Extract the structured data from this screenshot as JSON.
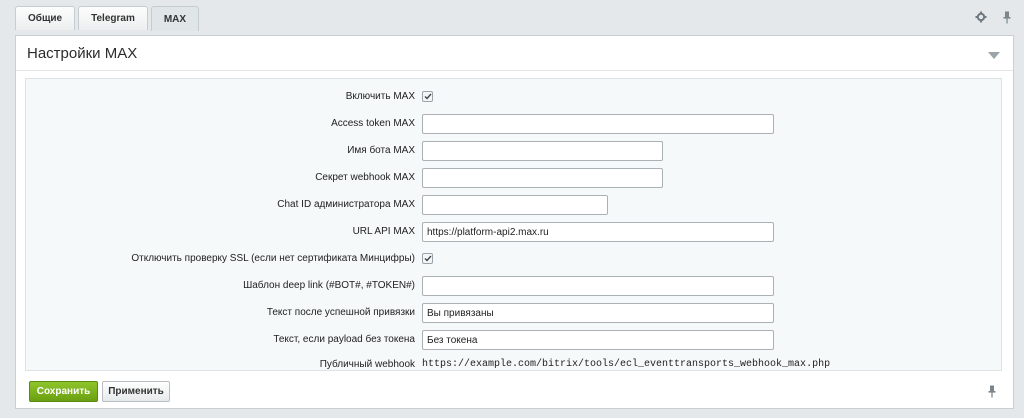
{
  "tabs": [
    {
      "label": "Общие"
    },
    {
      "label": "Telegram"
    },
    {
      "label": "MAX"
    }
  ],
  "active_tab": "MAX",
  "tab_tools": {
    "settings_icon": "gear-icon",
    "pin_icon": "pin-icon"
  },
  "panel": {
    "title": "Настройки MAX",
    "collapse_icon": "triangle-down-icon"
  },
  "form": {
    "enable_max": {
      "label": "Включить MAX",
      "checked": true
    },
    "access_token": {
      "label": "Access token MAX",
      "value": ""
    },
    "bot_name": {
      "label": "Имя бота MAX",
      "value": ""
    },
    "webhook_secret": {
      "label": "Секрет webhook MAX",
      "value": ""
    },
    "admin_chat_id": {
      "label": "Chat ID администратора MAX",
      "value": ""
    },
    "api_url": {
      "label": "URL API MAX",
      "value": "https://platform-api2.max.ru"
    },
    "disable_ssl": {
      "label": "Отключить проверку SSL (если нет сертификата Минцифры)",
      "checked": true
    },
    "deep_link_template": {
      "label": "Шаблон deep link (#BOT#, #TOKEN#)",
      "value": ""
    },
    "success_text": {
      "label": "Текст после успешной привязки",
      "value": "Вы привязаны"
    },
    "no_token_text": {
      "label": "Текст, если payload без токена",
      "value": "Без токена"
    },
    "public_webhook": {
      "label": "Публичный webhook",
      "value": "https://example.com/bitrix/tools/ecl_eventtransports_webhook_max.php"
    }
  },
  "footer": {
    "save_label": "Сохранить",
    "apply_label": "Применить"
  },
  "colors": {
    "save_button": "#7ab01e",
    "panel_background": "#f5f9f9",
    "page_background": "#e4e8ea"
  }
}
